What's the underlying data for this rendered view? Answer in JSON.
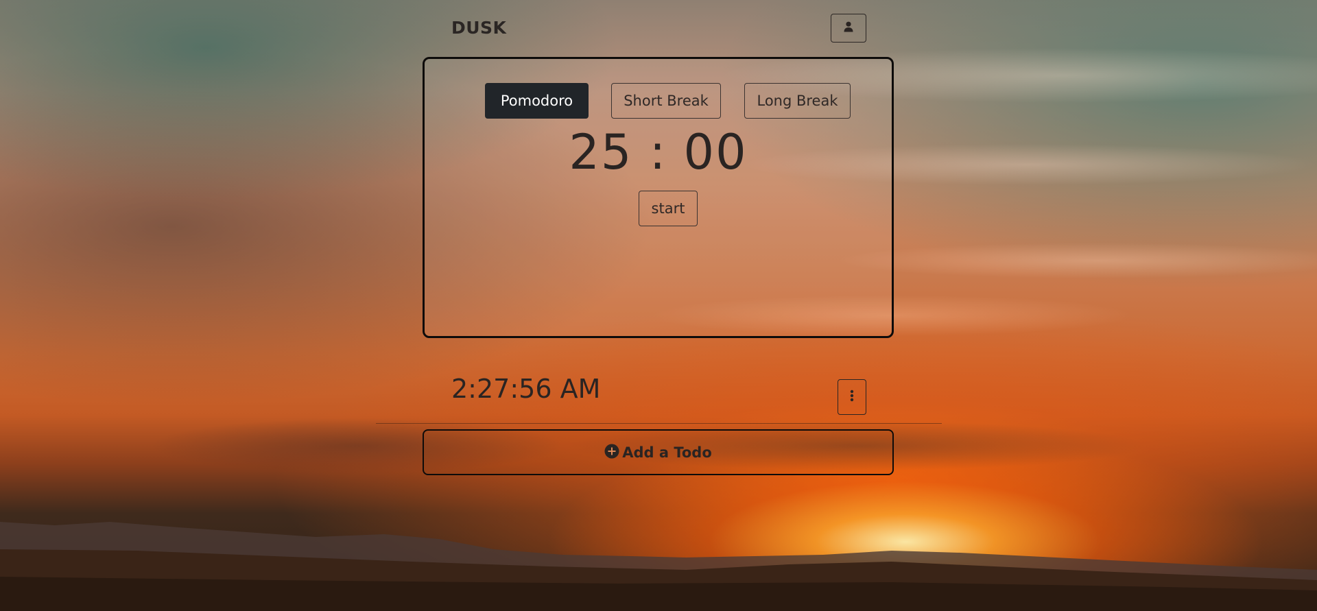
{
  "header": {
    "brand": "DUSK",
    "user_icon": "user-icon"
  },
  "timer": {
    "modes": [
      {
        "label": "Pomodoro",
        "active": true
      },
      {
        "label": "Short Break",
        "active": false
      },
      {
        "label": "Long Break",
        "active": false
      }
    ],
    "display": "25 : 00",
    "start_label": "start"
  },
  "clock": {
    "time": "2:27:56 AM",
    "menu_icon": "kebab-vertical-icon"
  },
  "todo": {
    "add_label": "Add a Todo",
    "add_icon": "plus-circle-icon"
  },
  "colors": {
    "active_tab_bg": "#212529",
    "active_tab_text": "#ffffff",
    "text_dark": "#2a2422",
    "border_dark": "#0d0b0a"
  }
}
